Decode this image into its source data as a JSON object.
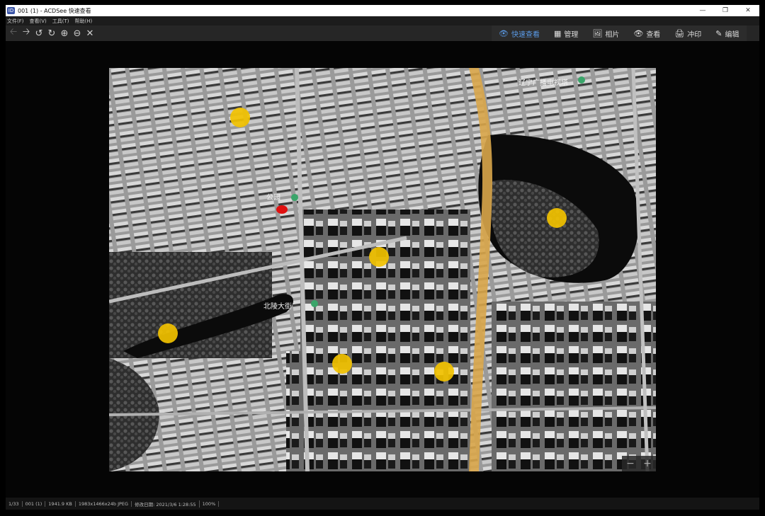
{
  "window": {
    "title": "001 (1) - ACDSee 快速查看",
    "icon_text": "ID"
  },
  "window_controls": {
    "minimize": "—",
    "maximize": "❐",
    "close": "✕"
  },
  "menu": [
    "文件(F)",
    "查看(V)",
    "工具(T)",
    "帮助(H)"
  ],
  "toolbar": {
    "back": "🡠",
    "forward": "🡢",
    "rotate_left": "↺",
    "rotate_right": "↻",
    "zoom_in": "⊕",
    "zoom_out": "⊖",
    "close": "✕"
  },
  "modes": [
    {
      "label": "快速查看",
      "icon": "👁"
    },
    {
      "label": "管理",
      "icon": "▦"
    },
    {
      "label": "相片",
      "icon": "🖼"
    },
    {
      "label": "查看",
      "icon": "👁"
    },
    {
      "label": "冲印",
      "icon": "🖨"
    },
    {
      "label": "编辑",
      "icon": "✎"
    }
  ],
  "map_labels": {
    "tower": "辽宁广播电视塔",
    "park": "公园",
    "bridge": "北陵大街"
  },
  "zoom_controls": {
    "minus": "−",
    "plus": "+"
  },
  "status": [
    "1/33",
    "001 (1)",
    "1941.9 KB",
    "1983x1466x24b JPEG",
    "修改日期: 2021/3/6 1:28:55",
    "100%"
  ],
  "colors": {
    "accent": "#5a9ae6",
    "marker_yellow": "#f2c200",
    "marker_red": "#e01010",
    "road_orange": "#d9a64a"
  }
}
